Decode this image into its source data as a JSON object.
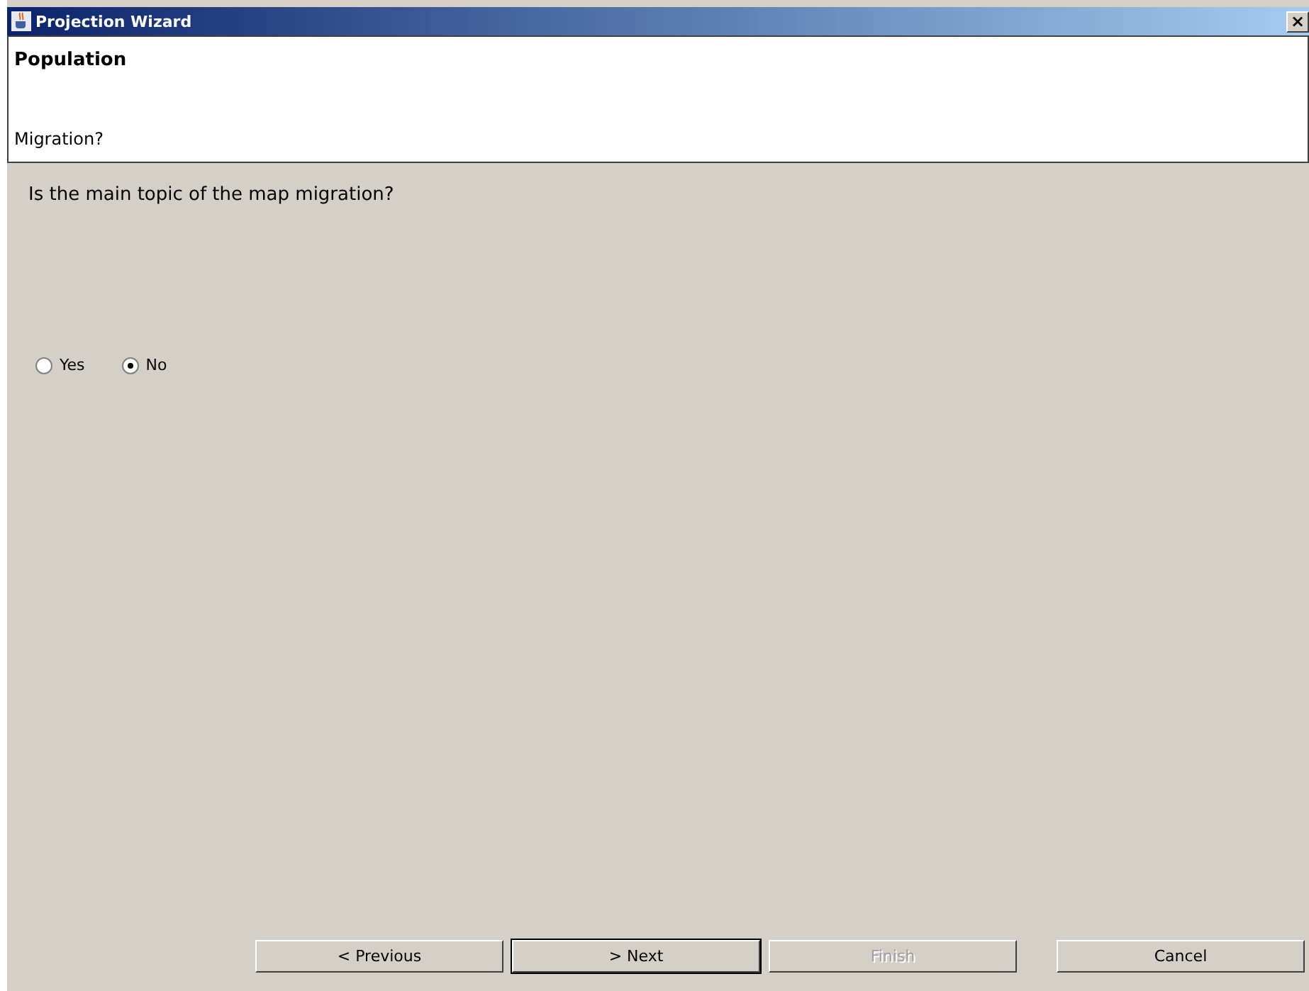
{
  "window": {
    "title": "Projection Wizard",
    "close": "×"
  },
  "header": {
    "title": "Population",
    "subtitle": "Migration?"
  },
  "question": "Is the main topic of the map migration?",
  "options": [
    {
      "label": "Yes",
      "selected": false
    },
    {
      "label": "No",
      "selected": true
    }
  ],
  "buttons": [
    {
      "label": "< Previous",
      "disabled": false,
      "focused": false
    },
    {
      "label": "> Next",
      "disabled": false,
      "focused": true
    },
    {
      "label": "Finish",
      "disabled": true,
      "focused": false
    },
    {
      "label": "Cancel",
      "disabled": false,
      "focused": false
    }
  ]
}
